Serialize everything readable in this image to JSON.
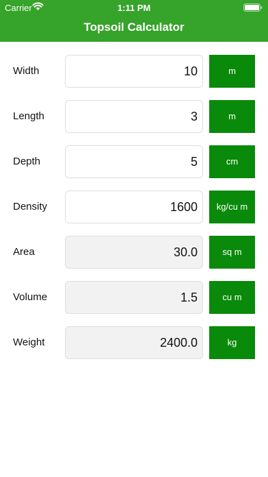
{
  "status_bar": {
    "carrier": "Carrier",
    "time": "1:11 PM"
  },
  "nav": {
    "title": "Topsoil Calculator"
  },
  "colors": {
    "header": "#36a32a",
    "unit_button": "#0a8a0a",
    "readonly_field": "#f2f2f2"
  },
  "rows": [
    {
      "label": "Width",
      "value": "10",
      "unit": "m",
      "editable": true
    },
    {
      "label": "Length",
      "value": "3",
      "unit": "m",
      "editable": true
    },
    {
      "label": "Depth",
      "value": "5",
      "unit": "cm",
      "editable": true
    },
    {
      "label": "Density",
      "value": "1600",
      "unit": "kg/cu m",
      "editable": true
    },
    {
      "label": "Area",
      "value": "30.0",
      "unit": "sq m",
      "editable": false
    },
    {
      "label": "Volume",
      "value": "1.5",
      "unit": "cu m",
      "editable": false
    },
    {
      "label": "Weight",
      "value": "2400.0",
      "unit": "kg",
      "editable": false
    }
  ]
}
